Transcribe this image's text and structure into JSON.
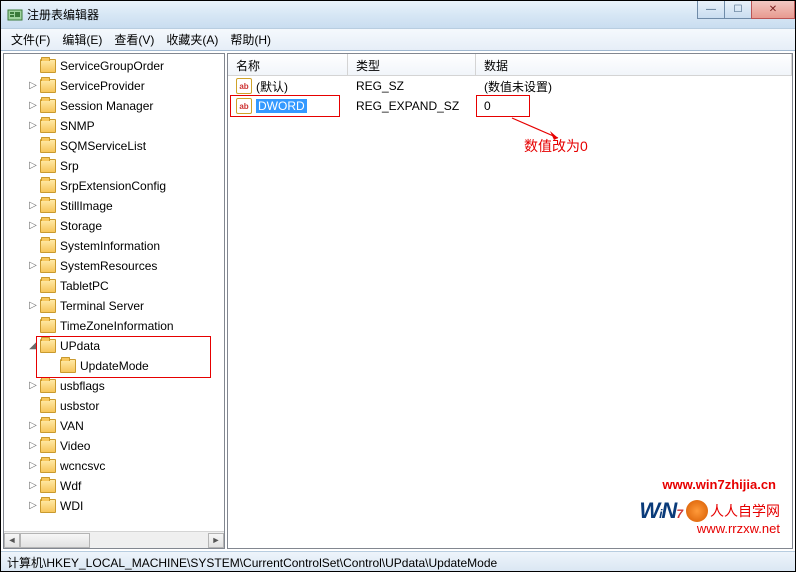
{
  "window": {
    "title": "注册表编辑器"
  },
  "menu": {
    "file": "文件(F)",
    "edit": "编辑(E)",
    "view": "查看(V)",
    "fav": "收藏夹(A)",
    "help": "帮助(H)"
  },
  "tree": {
    "items": [
      {
        "label": "ServiceGroupOrder",
        "exp": ""
      },
      {
        "label": "ServiceProvider",
        "exp": "▷"
      },
      {
        "label": "Session Manager",
        "exp": "▷"
      },
      {
        "label": "SNMP",
        "exp": "▷"
      },
      {
        "label": "SQMServiceList",
        "exp": ""
      },
      {
        "label": "Srp",
        "exp": "▷"
      },
      {
        "label": "SrpExtensionConfig",
        "exp": ""
      },
      {
        "label": "StillImage",
        "exp": "▷"
      },
      {
        "label": "Storage",
        "exp": "▷"
      },
      {
        "label": "SystemInformation",
        "exp": ""
      },
      {
        "label": "SystemResources",
        "exp": "▷"
      },
      {
        "label": "TabletPC",
        "exp": ""
      },
      {
        "label": "Terminal Server",
        "exp": "▷"
      },
      {
        "label": "TimeZoneInformation",
        "exp": ""
      },
      {
        "label": "UPdata",
        "exp": "◢"
      },
      {
        "label": "UpdateMode",
        "exp": "",
        "child": true
      },
      {
        "label": "usbflags",
        "exp": "▷"
      },
      {
        "label": "usbstor",
        "exp": ""
      },
      {
        "label": "VAN",
        "exp": "▷"
      },
      {
        "label": "Video",
        "exp": "▷"
      },
      {
        "label": "wcncsvc",
        "exp": "▷"
      },
      {
        "label": "Wdf",
        "exp": "▷"
      },
      {
        "label": "WDI",
        "exp": "▷"
      }
    ]
  },
  "list": {
    "cols": {
      "name": "名称",
      "type": "类型",
      "data": "数据"
    },
    "rows": [
      {
        "name": "(默认)",
        "type": "REG_SZ",
        "data": "(数值未设置)",
        "sel": false
      },
      {
        "name": "DWORD",
        "type": "REG_EXPAND_SZ",
        "data": "0",
        "sel": true
      }
    ]
  },
  "annotation": {
    "text": "数值改为0"
  },
  "status": {
    "path": "计算机\\HKEY_LOCAL_MACHINE\\SYSTEM\\CurrentControlSet\\Control\\UPdata\\UpdateMode"
  },
  "watermark": {
    "url1": "www.win7zhijia.cn",
    "logo": "WiN7",
    "url2": "www.rrzxw.net",
    "zixue": "人人自学网"
  }
}
